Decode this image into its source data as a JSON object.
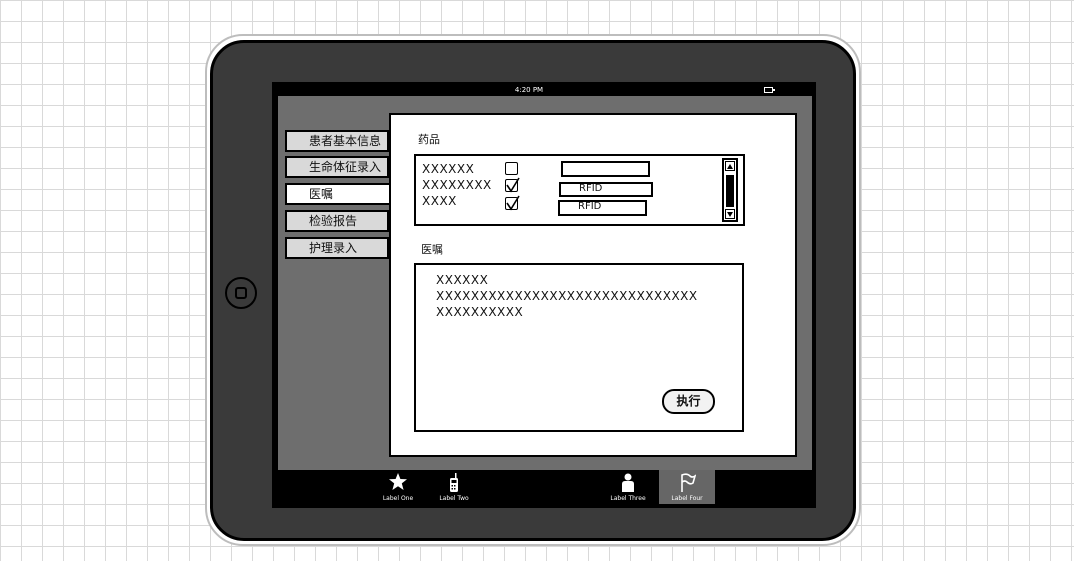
{
  "status_bar": {
    "time": "4:20 PM"
  },
  "sidebar": {
    "items": [
      {
        "label": "患者基本信息"
      },
      {
        "label": "生命体征录入"
      },
      {
        "label": "医嘱"
      },
      {
        "label": "检验报告"
      },
      {
        "label": "护理录入"
      }
    ],
    "active_index": 2
  },
  "medicine": {
    "title": "药品",
    "rows": [
      {
        "name": "XXXXXX",
        "checked": false,
        "rfid": ""
      },
      {
        "name": "XXXXXXXX",
        "checked": true,
        "rfid": "RFID"
      },
      {
        "name": "XXXX",
        "checked": true,
        "rfid": "RFID"
      }
    ]
  },
  "orders": {
    "title": "医嘱",
    "lines": [
      "XXXXXX",
      "XXXXXXXXXXXXXXXXXXXXXXXXXXXXXX",
      "XXXXXXXXXX"
    ],
    "execute_label": "执行"
  },
  "tabbar": {
    "items": [
      {
        "label": "Label One",
        "icon": "star-icon"
      },
      {
        "label": "Label Two",
        "icon": "phone-icon"
      },
      {
        "label": "Label Three",
        "icon": "person-icon"
      },
      {
        "label": "Label Four",
        "icon": "flag-icon"
      }
    ],
    "selected_index": 3
  }
}
